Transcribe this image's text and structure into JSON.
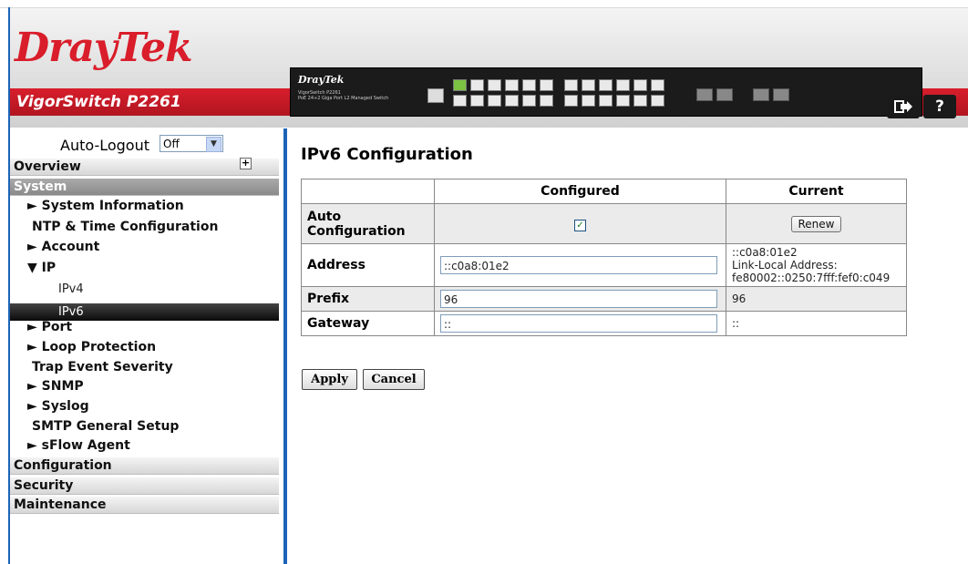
{
  "header": {
    "brand": "DrayTek",
    "model": "VigorSwitch P2261",
    "device_brand": "DrayTek",
    "device_model": "VigorSwitch P2261",
    "device_desc": "PoE 24+2 Giga Port L2 Managed Switch",
    "logout_icon": "logout-icon",
    "help_icon": "help-icon"
  },
  "sidebar": {
    "autologout_label": "Auto-Logout",
    "autologout_value": "Off",
    "sections": [
      "Overview",
      "System",
      "Configuration",
      "Security",
      "Maintenance"
    ],
    "items": [
      "► System Information",
      "NTP & Time Configuration",
      "► Account",
      "▼ IP",
      "► Port",
      "► Loop Protection",
      "Trap Event Severity",
      "► SNMP",
      "► Syslog",
      "SMTP General Setup",
      "► sFlow Agent"
    ],
    "ip_sub": [
      "IPv4",
      "IPv6"
    ]
  },
  "main": {
    "title": "IPv6 Configuration",
    "columns": [
      "Configured",
      "Current"
    ],
    "rows": {
      "auto": {
        "label": "Auto Configuration",
        "renew": "Renew"
      },
      "address": {
        "label": "Address",
        "configured": "::c0a8:01e2",
        "current": [
          "::c0a8:01e2",
          "Link-Local Address:",
          "fe80002::0250:7fff:fef0:c049"
        ]
      },
      "prefix": {
        "label": "Prefix",
        "configured": "96",
        "current": "96"
      },
      "gateway": {
        "label": "Gateway",
        "configured": "::",
        "current": "::"
      }
    },
    "apply": "Apply",
    "cancel": "Cancel"
  }
}
